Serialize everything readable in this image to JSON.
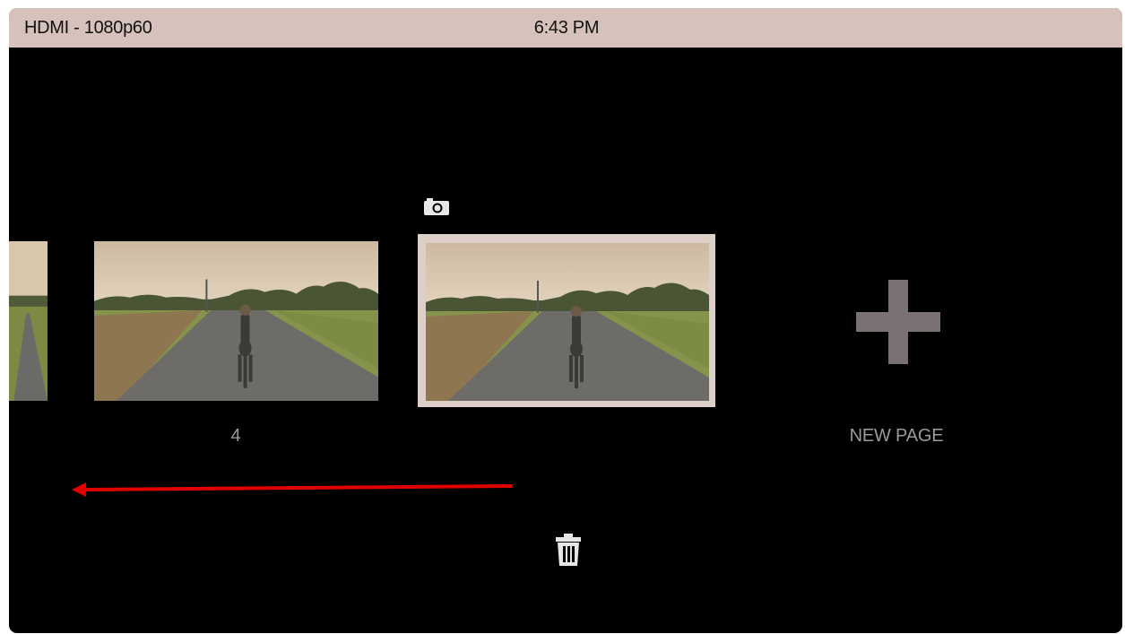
{
  "status_bar": {
    "input_label": "HDMI - 1080p60",
    "time": "6:43 PM"
  },
  "pages": {
    "page_4_label": "4",
    "new_page_label": "NEW PAGE"
  },
  "icons": {
    "camera": "camera-icon",
    "plus": "plus-icon",
    "trash": "trash-icon",
    "arrow": "left-arrow-annotation"
  },
  "colors": {
    "status_bar": "#d6c2bb",
    "selection_frame": "#ddcec8",
    "annotation_arrow": "#e10000"
  }
}
